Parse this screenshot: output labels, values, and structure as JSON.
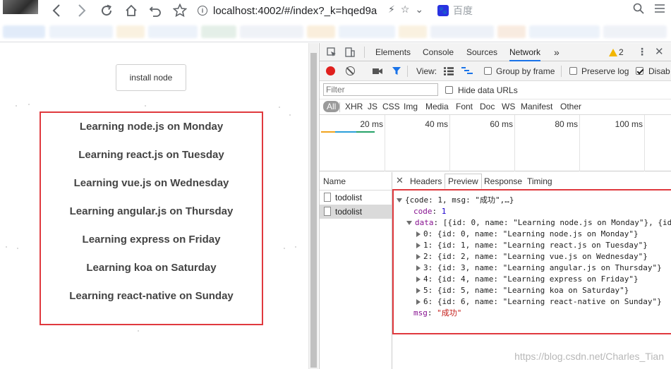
{
  "browser": {
    "url": "localhost:4002/#/index?_k=hqed9a",
    "search_engine": "百度"
  },
  "page": {
    "install_button": "install node",
    "todos": [
      "Learning node.js on Monday",
      "Learning react.js on Tuesday",
      "Learning vue.js on Wednesday",
      "Learning angular.js on Thursday",
      "Learning express on Friday",
      "Learning koa on Saturday",
      "Learning react-native on Sunday"
    ]
  },
  "devtools": {
    "tabs": [
      "Elements",
      "Console",
      "Sources",
      "Network"
    ],
    "active_tab": "Network",
    "more": "»",
    "warnings": "2",
    "toolbar": {
      "view_label": "View:",
      "group_by_frame": "Group by frame",
      "preserve_log": "Preserve log",
      "disable_cache": "Disab"
    },
    "filter_placeholder": "Filter",
    "hide_data_urls": "Hide data URLs",
    "types": [
      "All",
      "XHR",
      "JS",
      "CSS",
      "Img",
      "Media",
      "Font",
      "Doc",
      "WS",
      "Manifest",
      "Other"
    ],
    "timeline_ticks": [
      "20 ms",
      "40 ms",
      "60 ms",
      "80 ms",
      "100 ms"
    ],
    "name_header": "Name",
    "requests": [
      "todolist",
      "todolist"
    ],
    "detail_tabs": [
      "Headers",
      "Preview",
      "Response",
      "Timing"
    ],
    "preview": {
      "summary": "{code: 1, msg: \"成功\",…}",
      "code_key": "code",
      "code_val": "1",
      "data_key": "data",
      "data_summary": "[{id: 0, name: \"Learning node.js on Monday\"}, {id",
      "items": [
        "0: {id: 0, name: \"Learning node.js on Monday\"}",
        "1: {id: 1, name: \"Learning react.js on Tuesday\"}",
        "2: {id: 2, name: \"Learning vue.js on Wednesday\"}",
        "3: {id: 3, name: \"Learning angular.js on Thursday\"}",
        "4: {id: 4, name: \"Learning express on Friday\"}",
        "5: {id: 5, name: \"Learning koa on Saturday\"}",
        "6: {id: 6, name: \"Learning react-native on Sunday\"}"
      ],
      "msg_key": "msg",
      "msg_val": "\"成功\""
    }
  },
  "watermark": "https://blog.csdn.net/Charles_Tian"
}
